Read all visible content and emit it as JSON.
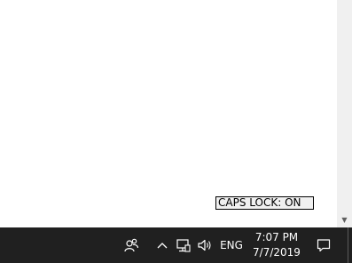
{
  "caps_lock": {
    "text": "CAPS LOCK: ON"
  },
  "taskbar": {
    "language": "ENG",
    "time": "7:07 PM",
    "date": "7/7/2019",
    "icons": {
      "people": "people-icon",
      "chevron": "chevron-up-icon",
      "network": "network-icon",
      "volume": "volume-icon",
      "action_center": "action-center-icon"
    }
  },
  "colors": {
    "taskbar_bg": "#202020",
    "scrollbar_bg": "#f0f0f0",
    "indicator_bg": "#f0f0f0"
  }
}
